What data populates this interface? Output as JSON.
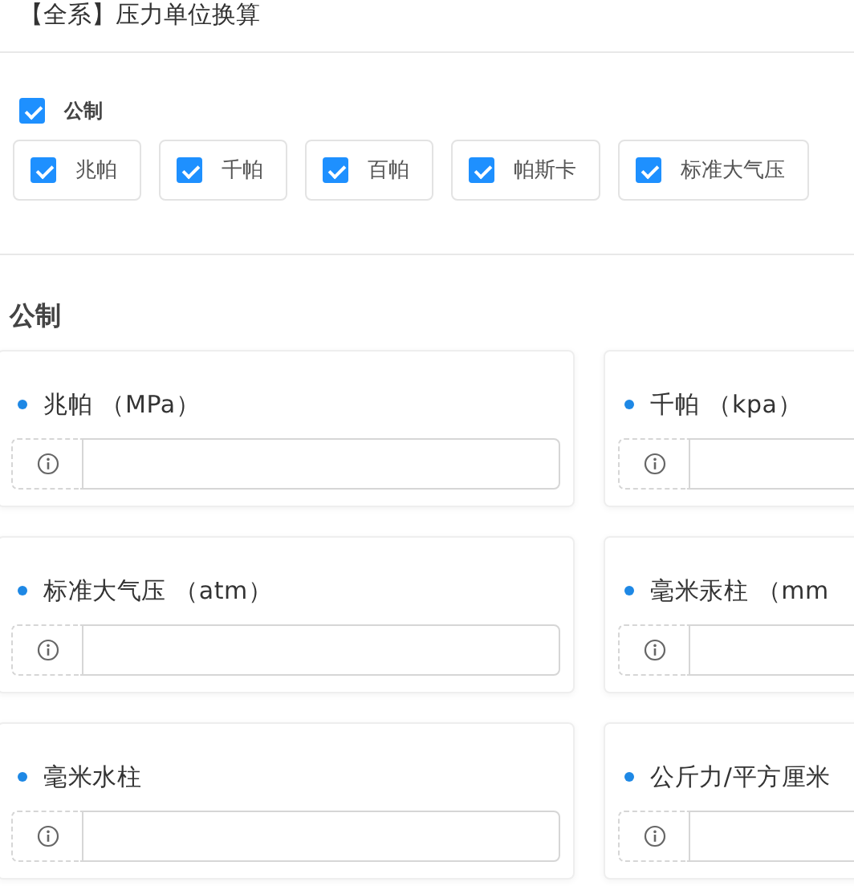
{
  "page_title": "【全系】压力单位换算",
  "group_toggle": {
    "label": "公制",
    "checked": true
  },
  "unit_filters": [
    {
      "label": "兆帕",
      "checked": true
    },
    {
      "label": "千帕",
      "checked": true
    },
    {
      "label": "百帕",
      "checked": true
    },
    {
      "label": "帕斯卡",
      "checked": true
    },
    {
      "label": "标准大气压",
      "checked": true
    }
  ],
  "section": {
    "heading": "公制",
    "units": [
      {
        "label": "兆帕 （MPa）"
      },
      {
        "label": "千帕 （kpa）"
      },
      {
        "label": "标准大气压 （atm）"
      },
      {
        "label": "毫米汞柱 （mm"
      },
      {
        "label": "毫米水柱"
      },
      {
        "label": "公斤力/平方厘米"
      }
    ]
  }
}
